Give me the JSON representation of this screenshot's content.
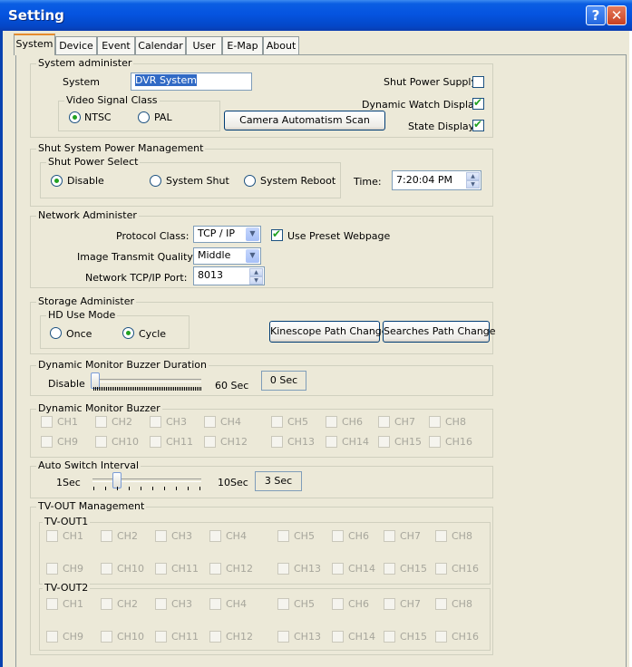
{
  "window": {
    "title": "Setting",
    "help_glyph": "?",
    "close_glyph": "✕"
  },
  "tabs": [
    {
      "label": "System",
      "active": true
    },
    {
      "label": "Device"
    },
    {
      "label": "Event"
    },
    {
      "label": "Calendar"
    },
    {
      "label": "User"
    },
    {
      "label": "E-Map"
    },
    {
      "label": "About"
    }
  ],
  "system_admin": {
    "title": "System administer",
    "system_label": "System",
    "system_value": "DVR System",
    "video_signal_title": "Video Signal Class",
    "ntsc_label": "NTSC",
    "pal_label": "PAL",
    "shut_power_supply_label": "Shut Power Supply:",
    "dynamic_watch_label": "Dynamic Watch Display:",
    "state_display_label": "State Display:",
    "camera_scan_label": "Camera Automatism Scan"
  },
  "shut_power": {
    "title": "Shut System Power Management",
    "select_title": "Shut Power Select",
    "disable_label": "Disable",
    "system_shut_label": "System Shut",
    "system_reboot_label": "System Reboot",
    "time_label": "Time:",
    "time_value": "7:20:04 PM"
  },
  "network": {
    "title": "Network Administer",
    "protocol_label": "Protocol Class:",
    "protocol_value": "TCP / IP",
    "preset_label": "Use Preset Webpage",
    "quality_label": "Image Transmit Quality::",
    "quality_value": "Middle",
    "port_label": "Network TCP/IP Port:",
    "port_value": "8013"
  },
  "storage": {
    "title": "Storage Administer",
    "hd_title": "HD Use Mode",
    "once_label": "Once",
    "cycle_label": "Cycle",
    "kinescope_label": "Kinescope Path Change",
    "searches_label": "Searches Path Change"
  },
  "buzzer_duration": {
    "title": "Dynamic Monitor Buzzer Duration",
    "min_label": "Disable",
    "max_label": "60 Sec",
    "value": "0 Sec"
  },
  "buzzer": {
    "title": "Dynamic Monitor Buzzer",
    "channels": [
      "CH1",
      "CH2",
      "CH3",
      "CH4",
      "CH5",
      "CH6",
      "CH7",
      "CH8",
      "CH9",
      "CH10",
      "CH11",
      "CH12",
      "CH13",
      "CH14",
      "CH15",
      "CH16"
    ]
  },
  "auto_switch": {
    "title": "Auto Switch Interval",
    "min_label": "1Sec",
    "max_label": "10Sec",
    "value": "3 Sec"
  },
  "tvout": {
    "title": "TV-OUT Management",
    "out1_title": "TV-OUT1",
    "out2_title": "TV-OUT2",
    "channels": [
      "CH1",
      "CH2",
      "CH3",
      "CH4",
      "CH5",
      "CH6",
      "CH7",
      "CH8",
      "CH9",
      "CH10",
      "CH11",
      "CH12",
      "CH13",
      "CH14",
      "CH15",
      "CH16"
    ]
  }
}
